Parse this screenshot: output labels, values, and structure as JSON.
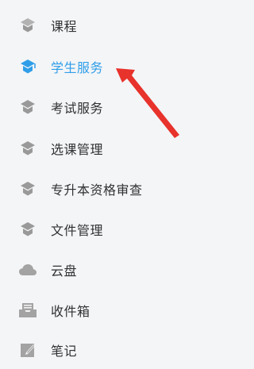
{
  "sidebar": {
    "items": [
      {
        "label": "课程",
        "icon": "course-icon"
      },
      {
        "label": "学生服务",
        "icon": "student-service-icon",
        "active": true
      },
      {
        "label": "考试服务",
        "icon": "exam-service-icon"
      },
      {
        "label": "选课管理",
        "icon": "course-selection-icon"
      },
      {
        "label": "专升本资格审查",
        "icon": "qualification-review-icon"
      },
      {
        "label": "文件管理",
        "icon": "file-management-icon"
      },
      {
        "label": "云盘",
        "icon": "cloud-icon"
      },
      {
        "label": "收件箱",
        "icon": "inbox-icon"
      },
      {
        "label": "笔记",
        "icon": "notes-icon"
      }
    ]
  },
  "colors": {
    "text": "#2f3133",
    "active": "#2f9ee8",
    "icon_gray": "#999999",
    "arrow": "#e8322c",
    "background": "#f4f5f7"
  }
}
